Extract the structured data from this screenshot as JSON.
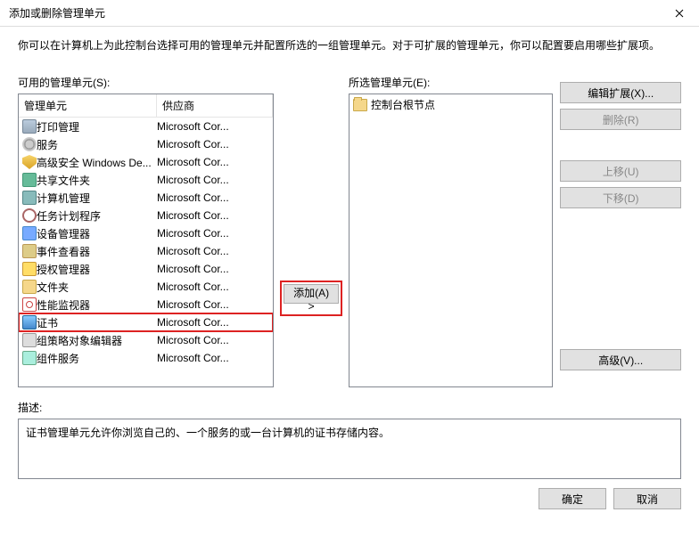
{
  "window": {
    "title": "添加或删除管理单元"
  },
  "instruction": "你可以在计算机上为此控制台选择可用的管理单元并配置所选的一组管理单元。对于可扩展的管理单元，你可以配置要启用哪些扩展项。",
  "available": {
    "label": "可用的管理单元(S):",
    "columns": {
      "name": "管理单元",
      "vendor": "供应商"
    },
    "items": [
      {
        "name": "打印管理",
        "vendor": "Microsoft Cor...",
        "icon": "printer"
      },
      {
        "name": "服务",
        "vendor": "Microsoft Cor...",
        "icon": "gear"
      },
      {
        "name": "高级安全 Windows De...",
        "vendor": "Microsoft Cor...",
        "icon": "shield"
      },
      {
        "name": "共享文件夹",
        "vendor": "Microsoft Cor...",
        "icon": "share"
      },
      {
        "name": "计算机管理",
        "vendor": "Microsoft Cor...",
        "icon": "pc"
      },
      {
        "name": "任务计划程序",
        "vendor": "Microsoft Cor...",
        "icon": "clock"
      },
      {
        "name": "设备管理器",
        "vendor": "Microsoft Cor...",
        "icon": "device"
      },
      {
        "name": "事件查看器",
        "vendor": "Microsoft Cor...",
        "icon": "event"
      },
      {
        "name": "授权管理器",
        "vendor": "Microsoft Cor...",
        "icon": "auth"
      },
      {
        "name": "文件夹",
        "vendor": "Microsoft Cor...",
        "icon": "folder"
      },
      {
        "name": "性能监视器",
        "vendor": "Microsoft Cor...",
        "icon": "perf"
      },
      {
        "name": "证书",
        "vendor": "Microsoft Cor...",
        "icon": "cert",
        "selected": true
      },
      {
        "name": "组策略对象编辑器",
        "vendor": "Microsoft Cor...",
        "icon": "gpo"
      },
      {
        "name": "组件服务",
        "vendor": "Microsoft Cor...",
        "icon": "comp"
      }
    ]
  },
  "selected": {
    "label": "所选管理单元(E):",
    "root": "控制台根节点"
  },
  "buttons": {
    "add": "添加(A) >",
    "edit_ext": "编辑扩展(X)...",
    "remove": "删除(R)",
    "move_up": "上移(U)",
    "move_down": "下移(D)",
    "advanced": "高级(V)...",
    "ok": "确定",
    "cancel": "取消"
  },
  "description": {
    "label": "描述:",
    "text": "证书管理单元允许你浏览自己的、一个服务的或一台计算机的证书存储内容。"
  }
}
